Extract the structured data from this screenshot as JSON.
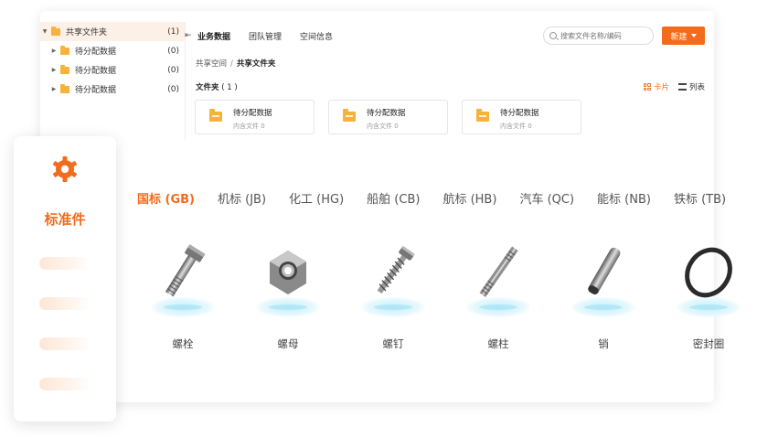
{
  "tree": {
    "root": {
      "label": "共享文件夹",
      "count": "(1)"
    },
    "children": [
      {
        "label": "待分配数据",
        "count": "(0)"
      },
      {
        "label": "待分配数据",
        "count": "(0)"
      },
      {
        "label": "待分配数据",
        "count": "(0)"
      }
    ]
  },
  "header": {
    "tabs": [
      "业务数据",
      "团队管理",
      "空间信息"
    ],
    "active_tab": 0,
    "search_placeholder": "搜索文件名称/编码",
    "new_button": "新建"
  },
  "breadcrumb": {
    "parent": "共享空间",
    "separator": "/",
    "current": "共享文件夹"
  },
  "folders": {
    "title": "文件夹",
    "count": "( 1 )",
    "view_card": "卡片",
    "view_list": "列表",
    "cards": [
      {
        "name": "待分配数据",
        "sub": "内含文件 0"
      },
      {
        "name": "待分配数据",
        "sub": "内含文件 0"
      },
      {
        "name": "待分配数据",
        "sub": "内含文件 0"
      }
    ]
  },
  "standard_panel": {
    "title": "标准件",
    "icon": "gear-icon",
    "accent": "#f36b1c"
  },
  "standard_tabs": [
    "国标 (GB)",
    "机标 (JB)",
    "化工 (HG)",
    "船舶 (CB)",
    "航标 (HB)",
    "汽车 (QC)",
    "能标 (NB)",
    "铁标 (TB)"
  ],
  "parts": [
    {
      "label": "螺栓",
      "icon": "bolt-icon"
    },
    {
      "label": "螺母",
      "icon": "nut-icon"
    },
    {
      "label": "螺钉",
      "icon": "screw-icon"
    },
    {
      "label": "螺柱",
      "icon": "stud-icon"
    },
    {
      "label": "销",
      "icon": "pin-icon"
    },
    {
      "label": "密封圈",
      "icon": "seal-ring-icon"
    }
  ]
}
